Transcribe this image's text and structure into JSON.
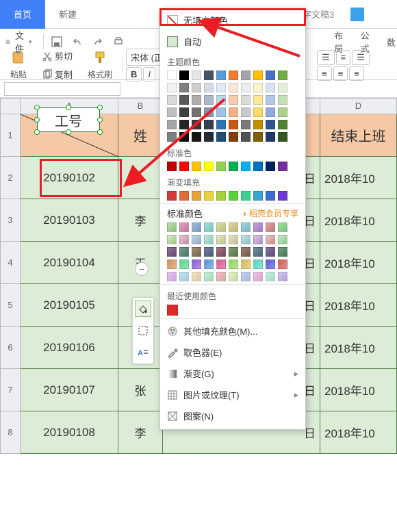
{
  "tabs": {
    "home": "首页",
    "new": "新建",
    "doc3": "字文稿3"
  },
  "ribbon": {
    "file": "文件",
    "layout": "布局",
    "formula": "公式",
    "data": "数",
    "paste": "粘贴",
    "cut": "剪切",
    "copy": "复制",
    "fmtpaint": "格式刷",
    "font_name": "宋体 (正"
  },
  "namebox": "",
  "columns": [
    "A",
    "B",
    "",
    "D"
  ],
  "header_row": {
    "A": "工号",
    "D": "结束上班"
  },
  "rows": [
    {
      "n": "2",
      "A": "20190102",
      "C_suffix": "日",
      "D": "2018年10"
    },
    {
      "n": "3",
      "A": "20190103",
      "B": "李",
      "C_suffix": "日",
      "D": "2018年10"
    },
    {
      "n": "4",
      "A": "20190104",
      "B": "王",
      "C_suffix": "日",
      "D": "2018年10"
    },
    {
      "n": "5",
      "A": "20190105",
      "B": "吴",
      "C_suffix": "日",
      "D": "2018年10"
    },
    {
      "n": "6",
      "A": "20190106",
      "B": "林",
      "C_suffix": "日",
      "D": "2018年10"
    },
    {
      "n": "7",
      "A": "20190107",
      "B": "张",
      "C_suffix": "日",
      "D": "2018年10"
    },
    {
      "n": "8",
      "A": "20190108",
      "B": "李",
      "C_suffix": "日",
      "D": "2018年10"
    }
  ],
  "textbox_value": "工号",
  "color_panel": {
    "no_fill": "无填充颜色",
    "auto": "自动",
    "theme": "主题颜色",
    "standard": "标准色",
    "gradient_fill": "渐变填充",
    "gradient_colors": "标准颜色",
    "premium": "稻壳会员专享",
    "recent": "最近使用颜色",
    "more_colors": "其他填充颜色(M)...",
    "eyedropper": "取色器(E)",
    "gradient_menu": "渐变(G)",
    "texture": "图片或纹理(T)",
    "pattern": "图案(N)"
  },
  "theme_colors_row1": [
    "#ffffff",
    "#000000",
    "#e7e6e6",
    "#44546a",
    "#5b9bd5",
    "#ed7d31",
    "#a5a5a5",
    "#ffc000",
    "#4472c4",
    "#70ad47"
  ],
  "theme_shades": [
    [
      "#f2f2f2",
      "#808080",
      "#d0cece",
      "#d6dce5",
      "#deebf7",
      "#fbe5d6",
      "#ededed",
      "#fff2cc",
      "#d9e2f3",
      "#e2f0d9"
    ],
    [
      "#d9d9d9",
      "#595959",
      "#aeabab",
      "#adb9ca",
      "#bdd7ee",
      "#f8cbad",
      "#dbdbdb",
      "#ffe699",
      "#b4c7e7",
      "#c5e0b4"
    ],
    [
      "#bfbfbf",
      "#404040",
      "#757070",
      "#8497b0",
      "#9dc3e6",
      "#f4b183",
      "#c9c9c9",
      "#ffd966",
      "#8faadc",
      "#a9d18e"
    ],
    [
      "#a6a6a6",
      "#262626",
      "#3b3838",
      "#333f50",
      "#2e75b6",
      "#c55a11",
      "#7b7b7b",
      "#bf9000",
      "#2f5597",
      "#548235"
    ],
    [
      "#7f7f7f",
      "#0d0d0d",
      "#171616",
      "#222a35",
      "#1f4e79",
      "#843c0c",
      "#525252",
      "#806000",
      "#203864",
      "#385723"
    ]
  ],
  "standard_colors": [
    "#c00000",
    "#ff0000",
    "#ffc000",
    "#ffff00",
    "#92d050",
    "#00b050",
    "#00b0f0",
    "#0070c0",
    "#002060",
    "#7030a0"
  ],
  "gradient_fill_row": [
    "#d63a3a",
    "#e06c3a",
    "#e8a03a",
    "#e8d13a",
    "#a5d13a",
    "#56d13a",
    "#3ad18f",
    "#3aa5d1",
    "#3a6cd1",
    "#6c3ad1"
  ],
  "grad_presets": [
    [
      "#bde0b0,#8fc17a",
      "#e0a1bd,#c17a9a",
      "#a1bde0,#7a9ac1",
      "#a1e0d8,#7ac1b7",
      "#d3e0a1,#b7c17a",
      "#e0d3a1,#c1b77a",
      "#a1d3e0,#7ab7c1",
      "#c6a1e0,#a17ac1",
      "#e0a1a1,#c17a7a",
      "#a1e0a1,#7ac17a"
    ],
    [
      "#d9e9c8,#9fc48c",
      "#e9c8d5,#c48caa",
      "#c8d5e9,#8caac4",
      "#c8e9e4,#8cc4bb",
      "#e4e9c8,#bbc48c",
      "#e9e4c8,#c4bb8c",
      "#c8e4e9,#8cbbc4",
      "#dac8e9,#ad8cc4",
      "#e9c8c8,#c48c8c",
      "#c8e9c8,#8cc48c"
    ],
    [
      "#9070a0,#634b73",
      "#70a090,#4b7363",
      "#a09070,#73634b",
      "#7080a0,#4b5a73",
      "#a07080,#734b5a",
      "#80a070,#5a734b",
      "#a08070,#735a4b",
      "#7090a0,#4b6373",
      "#8a70a0,#5d4b73",
      "#70a080,#4b735a"
    ],
    [
      "#d18f5c,#e6b98f",
      "#5cd18f,#8fe6b9",
      "#8f5cd1,#b98fe6",
      "#5c8fd1,#8fb9e6",
      "#d15c8f,#e68fb9",
      "#8fd15c,#b9e68f",
      "#d1b95c,#e6d68f",
      "#5cd1b9,#8fe6d6",
      "#5c5cd1,#8f8fe6",
      "#d15c5c,#e68f8f"
    ],
    [
      "#e6c8f0,#c8a1d9",
      "#c8e6f0,#a1c8d9",
      "#f0e6c8,#d9c8a1",
      "#c8f0d5,#a1d9b4",
      "#f0c8c8,#d9a1a1",
      "#e6f0c8,#c8d9a1",
      "#c8d5f0,#a1b4d9",
      "#f0c8e6,#d9a1c8",
      "#c8f0e6,#a1d9c8",
      "#d5c8f0,#b4a1d9"
    ]
  ]
}
